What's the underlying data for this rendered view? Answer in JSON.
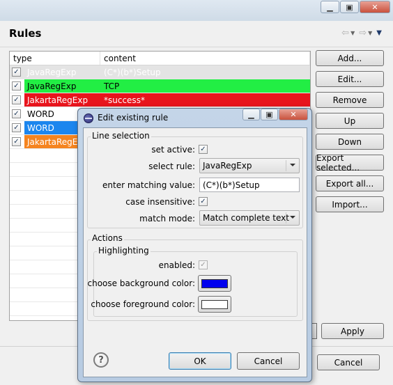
{
  "background": {
    "page_title": "Rules",
    "table": {
      "headers": {
        "type": "type",
        "content": "content"
      },
      "rows": [
        {
          "checked": true,
          "type": "JavaRegExp",
          "content": "(C*)(b*)Setup",
          "type_bg": "",
          "content_bg": "",
          "faded": true
        },
        {
          "checked": true,
          "type": "JavaRegExp",
          "content": "TCP",
          "type_bg": "#22ee44",
          "content_bg": "#22ee44",
          "faded": false
        },
        {
          "checked": true,
          "type": "JakartaRegExp",
          "content": "*success*",
          "type_bg": "#e8141c",
          "content_bg": "#e8141c",
          "faded": false,
          "fg": "#ffffff"
        },
        {
          "checked": true,
          "type": "WORD",
          "content": "",
          "type_bg": "",
          "content_bg": "",
          "faded": false
        },
        {
          "checked": true,
          "type": "WORD",
          "content": "",
          "type_bg": "#1c86ee",
          "content_bg": "",
          "faded": false,
          "fg": "#ffffff"
        },
        {
          "checked": true,
          "type": "JakartaRegExp",
          "content": "",
          "type_bg": "#f5841f",
          "content_bg": "",
          "faded": false,
          "fg": "#ffffff"
        }
      ]
    },
    "side_buttons": {
      "add": "Add...",
      "edit": "Edit...",
      "remove": "Remove",
      "up": "Up",
      "down": "Down",
      "export_selected": "Export selected...",
      "export_all": "Export all...",
      "import": "Import..."
    },
    "apply": "Apply",
    "cancel": "Cancel"
  },
  "dialog": {
    "title": "Edit existing rule",
    "line_selection": {
      "group_label": "Line selection",
      "set_active_label": "set active:",
      "set_active": true,
      "select_rule_label": "select rule:",
      "select_rule_value": "JavaRegExp",
      "matching_value_label": "enter matching value:",
      "matching_value": "(C*)(b*)Setup",
      "case_insensitive_label": "case insensitive:",
      "case_insensitive": true,
      "match_mode_label": "match mode:",
      "match_mode_value": "Match complete text"
    },
    "actions": {
      "group_label": "Actions",
      "highlighting": {
        "group_label": "Highlighting",
        "enabled_label": "enabled:",
        "enabled": true,
        "bg_color_label": "choose background color:",
        "bg_color": "#0000ee",
        "fg_color_label": "choose foreground color:",
        "fg_color": "#ffffff"
      }
    },
    "ok": "OK",
    "cancel": "Cancel",
    "help_glyph": "?"
  }
}
